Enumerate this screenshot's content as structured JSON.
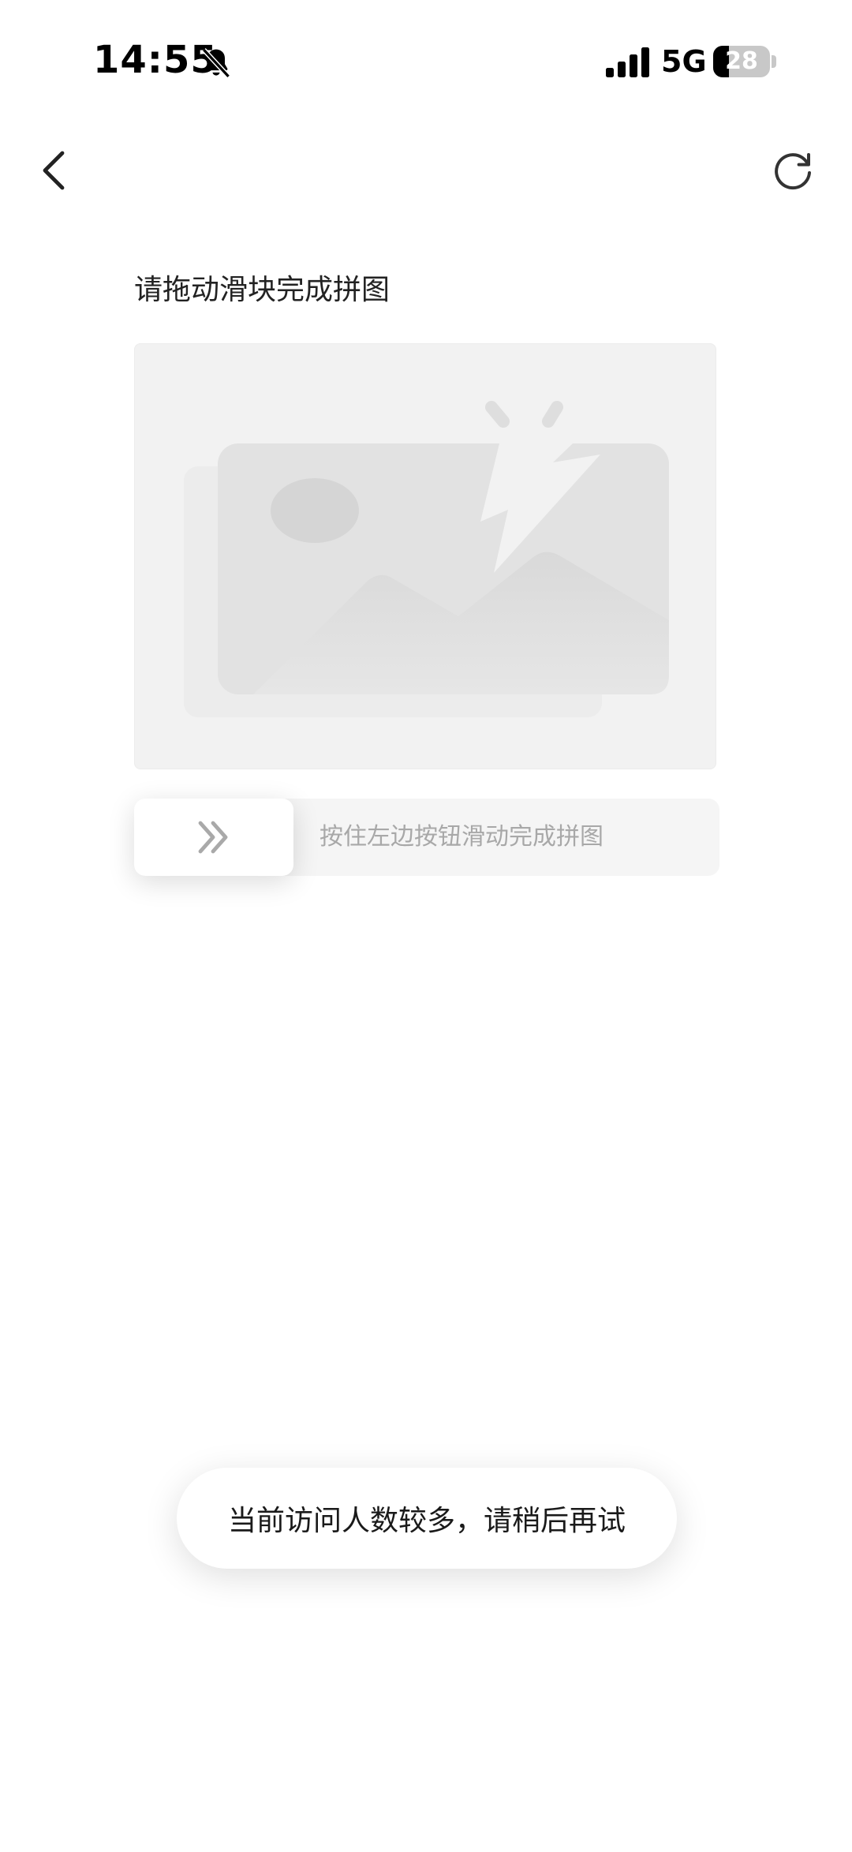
{
  "status_bar": {
    "time": "14:55",
    "network": "5G",
    "battery_level": "28",
    "battery_fraction": 0.28,
    "icons": [
      "bell-slash-icon",
      "signal-bars-icon",
      "battery-icon"
    ]
  },
  "nav": {
    "back_icon": "chevron-left-icon",
    "refresh_icon": "refresh-icon"
  },
  "captcha": {
    "title": "请拖动滑块完成拼图",
    "image_state": "broken-image-placeholder",
    "slider_hint": "按住左边按钮滑动完成拼图",
    "handle_icon": "double-chevron-right-icon"
  },
  "toast": {
    "message": "当前访问人数较多，请稍后再试"
  },
  "colors": {
    "background": "#ffffff",
    "placeholder": "#f2f2f2",
    "hint_text": "#a8a8a8",
    "icon_gray": "#aaaaaa"
  }
}
